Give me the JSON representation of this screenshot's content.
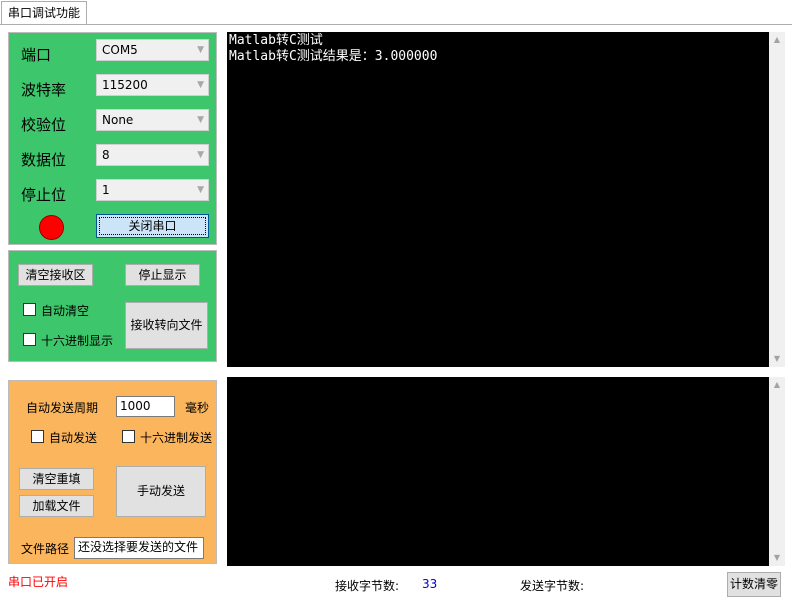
{
  "tab": {
    "label": "串口调试功能"
  },
  "serial": {
    "port_label": "端口",
    "port_value": "COM5",
    "baud_label": "波特率",
    "baud_value": "115200",
    "parity_label": "校验位",
    "parity_value": "None",
    "databits_label": "数据位",
    "databits_value": "8",
    "stopbits_label": "停止位",
    "stopbits_value": "1",
    "status_color": "#ff0000",
    "toggle_button": "关闭串口"
  },
  "receive": {
    "clear_button": "清空接收区",
    "stop_display_button": "停止显示",
    "auto_clear_label": "自动清空",
    "hex_display_label": "十六进制显示",
    "redirect_button": "接收转向文件",
    "output_lines": [
      "Matlab转C测试",
      "Matlab转C测试结果是：3.000000"
    ]
  },
  "send": {
    "period_label": "自动发送周期",
    "period_value": "1000",
    "period_unit": "毫秒",
    "auto_send_label": "自动发送",
    "hex_send_label": "十六进制发送",
    "clear_resend_button": "清空重填",
    "load_file_button": "加载文件",
    "manual_send_button": "手动发送",
    "file_path_label": "文件路径",
    "file_path_value": "还没选择要发送的文件"
  },
  "status": {
    "port_status": "串口已开启",
    "rx_label": "接收字节数:",
    "rx_count": "33",
    "tx_label": "发送字节数:",
    "tx_count": "",
    "reset_button": "计数清零"
  },
  "colors": {
    "serial_panel": "#3dc66b",
    "send_panel": "#fbb55c",
    "terminal_bg": "#000000",
    "status_red": "#ff0000",
    "count_blue": "#0000cc"
  }
}
